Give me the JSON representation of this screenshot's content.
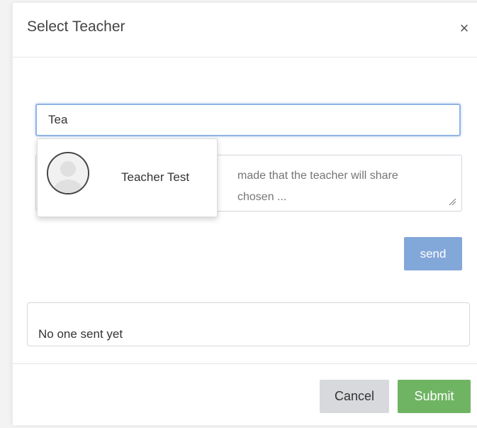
{
  "modal": {
    "title": "Select Teacher",
    "close_icon": "close-icon",
    "close_glyph": "×"
  },
  "search": {
    "value": "Tea"
  },
  "autocomplete": {
    "items": [
      {
        "name": "Teacher Test",
        "avatar_icon": "default-user-avatar-icon"
      }
    ]
  },
  "message": {
    "placeholder": "made that the teacher will share\nchosen ..."
  },
  "actions": {
    "send_label": "send"
  },
  "sent_list": {
    "empty_text": "No one sent yet"
  },
  "footer": {
    "cancel_label": "Cancel",
    "submit_label": "Submit"
  },
  "colors": {
    "send_button": "#82a7d9",
    "submit_button": "#6fb463",
    "cancel_button": "#d7d9dc",
    "focus_border": "#8fb5e3"
  }
}
